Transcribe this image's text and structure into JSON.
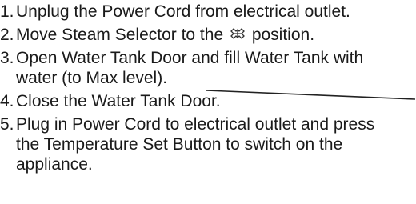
{
  "steps": [
    {
      "num": "1.",
      "lines": [
        "Unplug the Power Cord from electrical outlet."
      ]
    },
    {
      "num": "2.",
      "before_icon": "Move Steam Selector to the",
      "icon": "steam-symbol-icon",
      "after_icon": "position."
    },
    {
      "num": "3.",
      "lines": [
        "Open Water Tank Door and fill Water Tank with",
        "water (to Max level)."
      ]
    },
    {
      "num": "4.",
      "lines": [
        "Close the Water Tank Door."
      ]
    },
    {
      "num": "5.",
      "lines": [
        "Plug in Power Cord to electrical outlet and press",
        "the Temperature Set Button to switch on the",
        "appliance."
      ]
    }
  ]
}
